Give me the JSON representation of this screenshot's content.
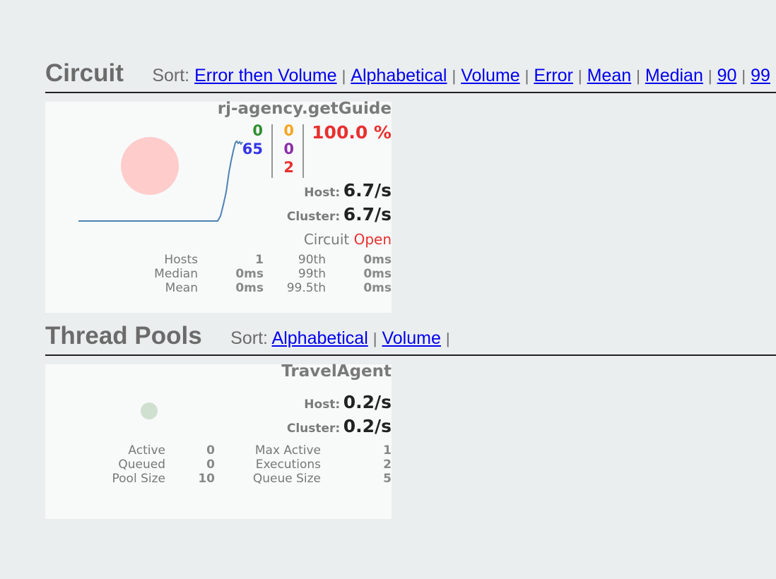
{
  "circuit_section": {
    "title": "Circuit",
    "sort_label": "Sort:",
    "sort_links": [
      "Error then Volume",
      "Alphabetical",
      "Volume",
      "Error",
      "Mean",
      "Median",
      "90",
      "99"
    ]
  },
  "circuit_card": {
    "name": "rj-agency.getGuide",
    "success_count": "0",
    "short_circuited_count": "65",
    "timeout_count": "0",
    "rejected_count": "0",
    "failure_count": "2",
    "error_percent": "100.0 %",
    "host_label": "Host:",
    "host_rate": "6.7/s",
    "cluster_label": "Cluster:",
    "cluster_rate": "6.7/s",
    "circuit_label": "Circuit",
    "circuit_status": "Open",
    "stats_left": [
      {
        "label": "Hosts",
        "value": "1"
      },
      {
        "label": "Median",
        "value": "0ms"
      },
      {
        "label": "Mean",
        "value": "0ms"
      }
    ],
    "stats_right": [
      {
        "label": "90th",
        "value": "0ms"
      },
      {
        "label": "99th",
        "value": "0ms"
      },
      {
        "label": "99.5th",
        "value": "0ms"
      }
    ]
  },
  "thread_section": {
    "title": "Thread Pools",
    "sort_label": "Sort:",
    "sort_links": [
      "Alphabetical",
      "Volume"
    ]
  },
  "pool_card": {
    "name": "TravelAgent",
    "host_label": "Host:",
    "host_rate": "0.2/s",
    "cluster_label": "Cluster:",
    "cluster_rate": "0.2/s",
    "stats_left": [
      {
        "label": "Active",
        "value": "0"
      },
      {
        "label": "Queued",
        "value": "0"
      },
      {
        "label": "Pool Size",
        "value": "10"
      }
    ],
    "stats_right": [
      {
        "label": "Max Active",
        "value": "1"
      },
      {
        "label": "Executions",
        "value": "2"
      },
      {
        "label": "Queue Size",
        "value": "5"
      }
    ]
  },
  "colors": {
    "success": "#2f8f2f",
    "short_circuited": "#3535e6",
    "timeout": "#f5a623",
    "rejected": "#8b2fa8",
    "failure": "#e8302f",
    "circuit_circle": "#ffcccc",
    "pool_circle": "#cfdfd0",
    "sparkline": "#4e82b4"
  }
}
